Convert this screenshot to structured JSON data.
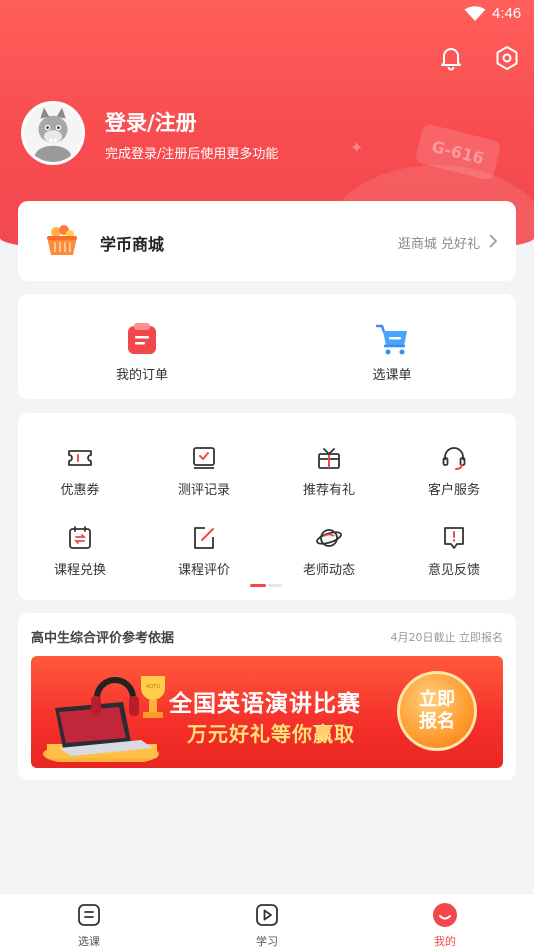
{
  "status_bar": {
    "time": "4:46"
  },
  "profile": {
    "name": "登录/注册",
    "subtitle": "完成登录/注册后使用更多功能",
    "plate_text": "G-616"
  },
  "mall": {
    "title": "学币商城",
    "link": "逛商城 兑好礼",
    "icon": "basket-icon"
  },
  "orders": [
    {
      "label": "我的订单",
      "icon": "order-icon"
    },
    {
      "label": "选课单",
      "icon": "cart-icon"
    }
  ],
  "tools": [
    {
      "label": "优惠券",
      "icon": "coupon-icon"
    },
    {
      "label": "测评记录",
      "icon": "assessment-icon"
    },
    {
      "label": "推荐有礼",
      "icon": "gift-icon"
    },
    {
      "label": "客户服务",
      "icon": "headset-icon"
    },
    {
      "label": "课程兑换",
      "icon": "exchange-icon"
    },
    {
      "label": "课程评价",
      "icon": "review-icon"
    },
    {
      "label": "老师动态",
      "icon": "planet-icon"
    },
    {
      "label": "意见反馈",
      "icon": "feedback-icon"
    }
  ],
  "event": {
    "title": "高中生综合评价参考依据",
    "meta": "4月20日截止 立即报名",
    "banner_line1": "全国英语演讲比赛",
    "banner_line2": "万元好礼等你赢取",
    "button_line1": "立即",
    "button_line2": "报名",
    "trophy_text": "ADTU"
  },
  "tabbar": [
    {
      "label": "选课",
      "icon": "course-icon"
    },
    {
      "label": "学习",
      "icon": "play-icon"
    },
    {
      "label": "我的",
      "icon": "profile-smile-icon",
      "active": true
    }
  ],
  "colors": {
    "brand_red": "#f2484d",
    "hero_top": "#ff5f5a",
    "banner_yellow": "#ffe27a"
  }
}
